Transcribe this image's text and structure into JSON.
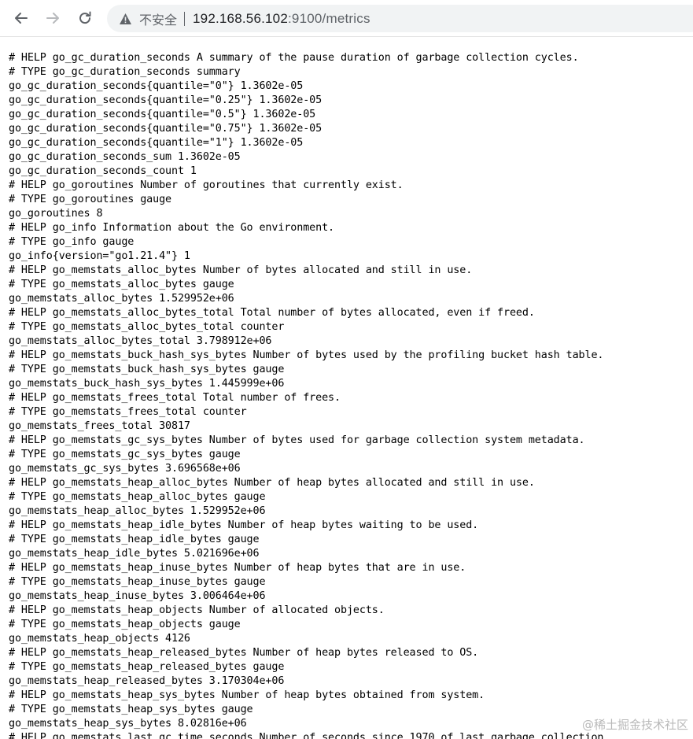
{
  "browser": {
    "security_label": "不安全",
    "url_host": "192.168.56.102",
    "url_rest": ":9100/metrics",
    "icons": {
      "back": "back-arrow-icon",
      "forward": "forward-arrow-icon",
      "reload": "reload-icon",
      "warning": "warning-triangle-icon"
    },
    "colors": {
      "toolbar_bg": "#ffffff",
      "omnibox_bg": "#f1f3f4",
      "muted_text": "#5f6368",
      "icon_color": "#5f6368"
    }
  },
  "metrics": {
    "lines": [
      "# HELP go_gc_duration_seconds A summary of the pause duration of garbage collection cycles.",
      "# TYPE go_gc_duration_seconds summary",
      "go_gc_duration_seconds{quantile=\"0\"} 1.3602e-05",
      "go_gc_duration_seconds{quantile=\"0.25\"} 1.3602e-05",
      "go_gc_duration_seconds{quantile=\"0.5\"} 1.3602e-05",
      "go_gc_duration_seconds{quantile=\"0.75\"} 1.3602e-05",
      "go_gc_duration_seconds{quantile=\"1\"} 1.3602e-05",
      "go_gc_duration_seconds_sum 1.3602e-05",
      "go_gc_duration_seconds_count 1",
      "# HELP go_goroutines Number of goroutines that currently exist.",
      "# TYPE go_goroutines gauge",
      "go_goroutines 8",
      "# HELP go_info Information about the Go environment.",
      "# TYPE go_info gauge",
      "go_info{version=\"go1.21.4\"} 1",
      "# HELP go_memstats_alloc_bytes Number of bytes allocated and still in use.",
      "# TYPE go_memstats_alloc_bytes gauge",
      "go_memstats_alloc_bytes 1.529952e+06",
      "# HELP go_memstats_alloc_bytes_total Total number of bytes allocated, even if freed.",
      "# TYPE go_memstats_alloc_bytes_total counter",
      "go_memstats_alloc_bytes_total 3.798912e+06",
      "# HELP go_memstats_buck_hash_sys_bytes Number of bytes used by the profiling bucket hash table.",
      "# TYPE go_memstats_buck_hash_sys_bytes gauge",
      "go_memstats_buck_hash_sys_bytes 1.445999e+06",
      "# HELP go_memstats_frees_total Total number of frees.",
      "# TYPE go_memstats_frees_total counter",
      "go_memstats_frees_total 30817",
      "# HELP go_memstats_gc_sys_bytes Number of bytes used for garbage collection system metadata.",
      "# TYPE go_memstats_gc_sys_bytes gauge",
      "go_memstats_gc_sys_bytes 3.696568e+06",
      "# HELP go_memstats_heap_alloc_bytes Number of heap bytes allocated and still in use.",
      "# TYPE go_memstats_heap_alloc_bytes gauge",
      "go_memstats_heap_alloc_bytes 1.529952e+06",
      "# HELP go_memstats_heap_idle_bytes Number of heap bytes waiting to be used.",
      "# TYPE go_memstats_heap_idle_bytes gauge",
      "go_memstats_heap_idle_bytes 5.021696e+06",
      "# HELP go_memstats_heap_inuse_bytes Number of heap bytes that are in use.",
      "# TYPE go_memstats_heap_inuse_bytes gauge",
      "go_memstats_heap_inuse_bytes 3.006464e+06",
      "# HELP go_memstats_heap_objects Number of allocated objects.",
      "# TYPE go_memstats_heap_objects gauge",
      "go_memstats_heap_objects 4126",
      "# HELP go_memstats_heap_released_bytes Number of heap bytes released to OS.",
      "# TYPE go_memstats_heap_released_bytes gauge",
      "go_memstats_heap_released_bytes 3.170304e+06",
      "# HELP go_memstats_heap_sys_bytes Number of heap bytes obtained from system.",
      "# TYPE go_memstats_heap_sys_bytes gauge",
      "go_memstats_heap_sys_bytes 8.02816e+06",
      "# HELP go_memstats_last_gc_time_seconds Number of seconds since 1970 of last garbage collection."
    ]
  },
  "watermark": {
    "text": "@稀土掘金技术社区"
  }
}
